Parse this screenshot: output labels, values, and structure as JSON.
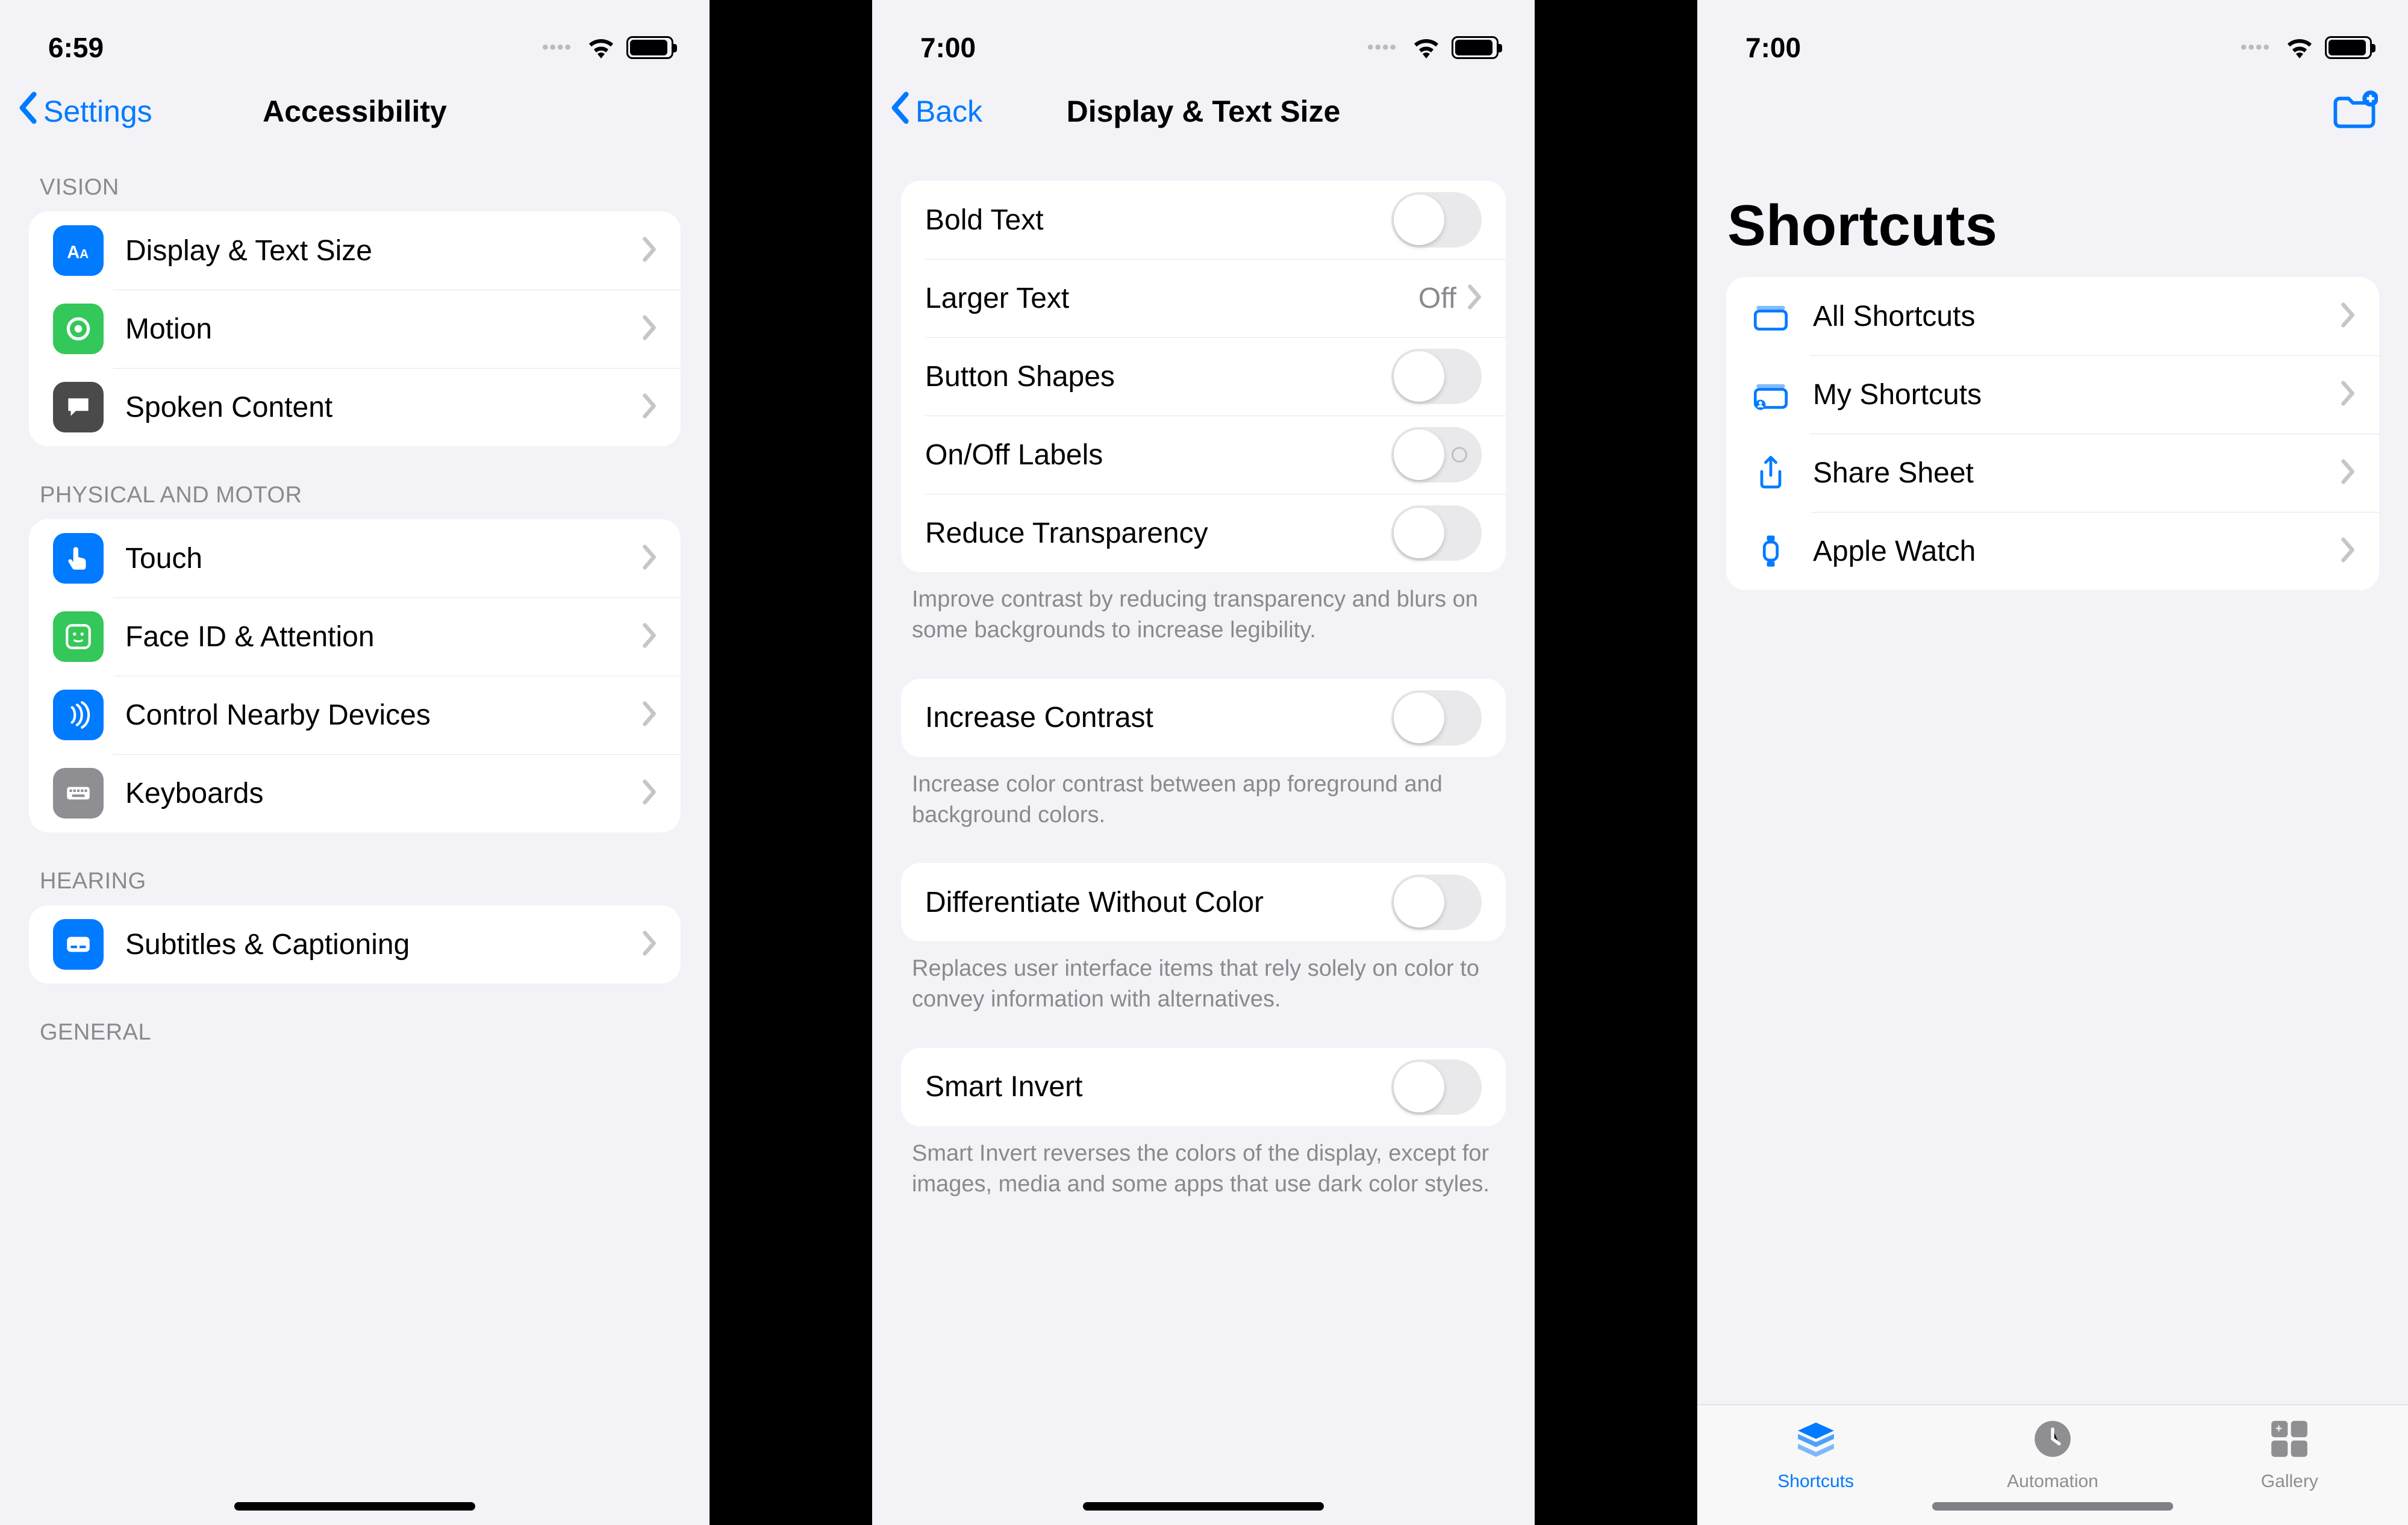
{
  "screens": {
    "accessibility": {
      "status_time": "6:59",
      "nav_back": "Settings",
      "nav_title": "Accessibility",
      "sections": [
        {
          "header": "VISION",
          "rows": [
            {
              "label": "Display & Text Size",
              "icon": "text-size",
              "bg": "#007aff"
            },
            {
              "label": "Motion",
              "icon": "motion",
              "bg": "#34c759"
            },
            {
              "label": "Spoken Content",
              "icon": "speech",
              "bg": "#4a4a4a"
            }
          ]
        },
        {
          "header": "PHYSICAL AND MOTOR",
          "rows": [
            {
              "label": "Touch",
              "icon": "touch",
              "bg": "#007aff"
            },
            {
              "label": "Face ID & Attention",
              "icon": "faceid",
              "bg": "#34c759"
            },
            {
              "label": "Control Nearby Devices",
              "icon": "nearby",
              "bg": "#007aff"
            },
            {
              "label": "Keyboards",
              "icon": "keyboard",
              "bg": "#8e8e93"
            }
          ]
        },
        {
          "header": "HEARING",
          "rows": [
            {
              "label": "Subtitles & Captioning",
              "icon": "subtitles",
              "bg": "#007aff"
            }
          ]
        },
        {
          "header": "GENERAL",
          "rows": []
        }
      ]
    },
    "display_text": {
      "status_time": "7:00",
      "nav_back": "Back",
      "nav_title": "Display & Text Size",
      "rows_a": [
        {
          "label": "Bold Text",
          "type": "toggle"
        },
        {
          "label": "Larger Text",
          "type": "nav",
          "value": "Off"
        },
        {
          "label": "Button Shapes",
          "type": "toggle"
        },
        {
          "label": "On/Off Labels",
          "type": "toggle_labels"
        },
        {
          "label": "Reduce Transparency",
          "type": "toggle"
        }
      ],
      "footer_a": "Improve contrast by reducing transparency and blurs on some backgrounds to increase legibility.",
      "rows_b": [
        {
          "label": "Increase Contrast",
          "type": "toggle"
        }
      ],
      "footer_b": "Increase color contrast between app foreground and background colors.",
      "rows_c": [
        {
          "label": "Differentiate Without Color",
          "type": "toggle"
        }
      ],
      "footer_c": "Replaces user interface items that rely solely on color to convey information with alternatives.",
      "rows_d": [
        {
          "label": "Smart Invert",
          "type": "toggle"
        }
      ],
      "footer_d": "Smart Invert reverses the colors of the display, except for images, media and some apps that use dark color styles."
    },
    "shortcuts": {
      "status_time": "7:00",
      "title": "Shortcuts",
      "rows": [
        {
          "label": "All Shortcuts",
          "icon": "folder"
        },
        {
          "label": "My Shortcuts",
          "icon": "folder-person"
        },
        {
          "label": "Share Sheet",
          "icon": "share"
        },
        {
          "label": "Apple Watch",
          "icon": "watch"
        }
      ],
      "tabs": [
        {
          "label": "Shortcuts",
          "icon": "stack",
          "active": true
        },
        {
          "label": "Automation",
          "icon": "clock",
          "active": false
        },
        {
          "label": "Gallery",
          "icon": "grid",
          "active": false
        }
      ]
    }
  }
}
